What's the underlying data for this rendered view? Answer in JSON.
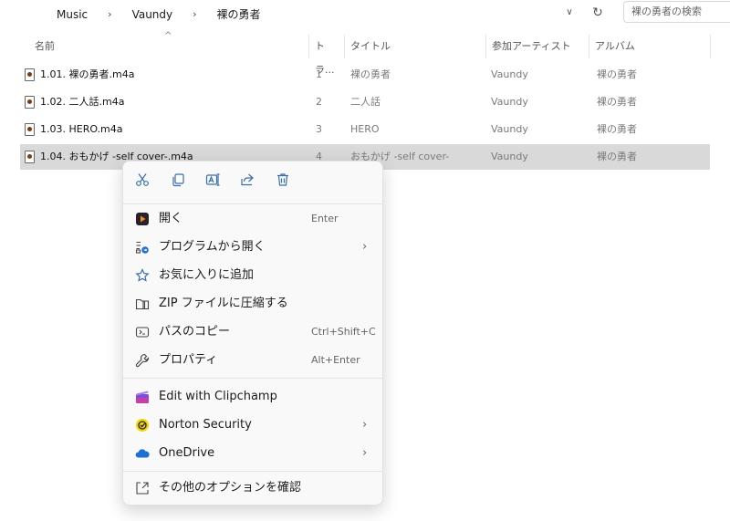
{
  "address": {
    "breadcrumbs": [
      "Music",
      "Vaundy",
      "裸の勇者"
    ],
    "search_placeholder": "裸の勇者の検索"
  },
  "columns": {
    "name": "名前",
    "track": "トラ...",
    "title": "タイトル",
    "artist": "参加アーティスト",
    "album": "アルバム"
  },
  "files": [
    {
      "name": "1.01. 裸の勇者.m4a",
      "track": "1",
      "title": "裸の勇者",
      "artist": "Vaundy",
      "album": "裸の勇者"
    },
    {
      "name": "1.02. 二人話.m4a",
      "track": "2",
      "title": "二人話",
      "artist": "Vaundy",
      "album": "裸の勇者"
    },
    {
      "name": "1.03. HERO.m4a",
      "track": "3",
      "title": "HERO",
      "artist": "Vaundy",
      "album": "裸の勇者"
    },
    {
      "name": "1.04. おもかげ -self cover-.m4a",
      "track": "4",
      "title": "おもかげ -self cover-",
      "artist": "Vaundy",
      "album": "裸の勇者"
    }
  ],
  "selected_row": 3,
  "context_menu": {
    "quick_actions": [
      "cut-icon",
      "copy-icon",
      "rename-icon",
      "share-icon",
      "delete-icon"
    ],
    "items": [
      {
        "label": "開く",
        "shortcut": "Enter"
      },
      {
        "label": "プログラムから開く",
        "submenu": "›"
      },
      {
        "label": "お気に入りに追加"
      },
      {
        "label": "ZIP ファイルに圧縮する"
      },
      {
        "label": "パスのコピー",
        "shortcut": "Ctrl+Shift+C"
      },
      {
        "label": "プロパティ",
        "shortcut": "Alt+Enter"
      },
      {
        "label": "Edit with Clipchamp"
      },
      {
        "label": "Norton Security",
        "submenu": "›"
      },
      {
        "label": "OneDrive",
        "submenu": "›"
      },
      {
        "label": "その他のオプションを確認"
      }
    ]
  },
  "colors": {
    "accent": "#3a6ea8",
    "selection": "#d9d9d9",
    "norton": "#f2d500",
    "onedrive": "#1d6fd1",
    "clipchamp": "#7b4fd6"
  }
}
